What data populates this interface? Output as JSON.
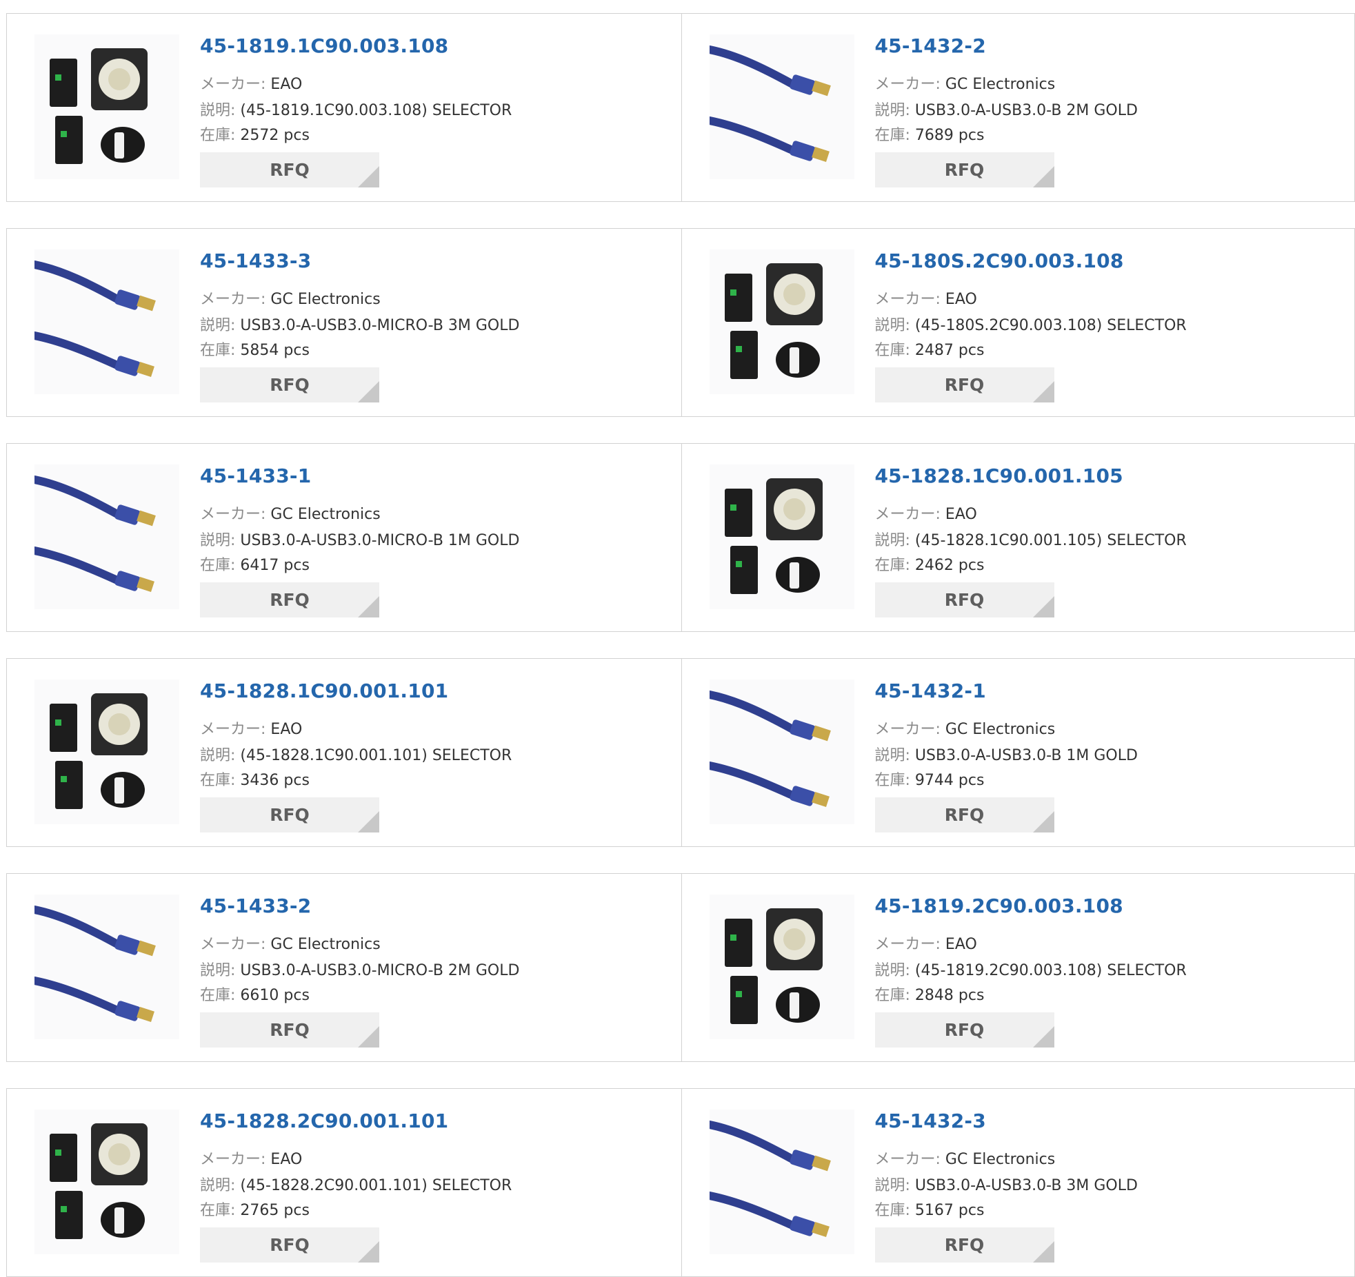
{
  "labels": {
    "maker": "メーカー:",
    "desc": "説明:",
    "stock": "在庫:",
    "rfq": "RFQ"
  },
  "colors": {
    "link": "#2466ac",
    "border": "#d2d2d2",
    "button_bg": "#f0f0f0",
    "cable_blue": "#2f3f8f",
    "connector_gold": "#c9a84a"
  },
  "products": [
    {
      "part": "45-1819.1C90.003.108",
      "maker": "EAO",
      "desc": "(45-1819.1C90.003.108) SELECTOR",
      "stock": "2572 pcs",
      "image": "selector-icon"
    },
    {
      "part": "45-1432-2",
      "maker": "GC Electronics",
      "desc": "USB3.0-A-USB3.0-B 2M GOLD",
      "stock": "7689 pcs",
      "image": "usb-cable-icon"
    },
    {
      "part": "45-1433-3",
      "maker": "GC Electronics",
      "desc": "USB3.0-A-USB3.0-MICRO-B 3M GOLD",
      "stock": "5854 pcs",
      "image": "usb-cable-icon"
    },
    {
      "part": "45-180S.2C90.003.108",
      "maker": "EAO",
      "desc": "(45-180S.2C90.003.108) SELECTOR",
      "stock": "2487 pcs",
      "image": "selector-icon"
    },
    {
      "part": "45-1433-1",
      "maker": "GC Electronics",
      "desc": "USB3.0-A-USB3.0-MICRO-B 1M GOLD",
      "stock": "6417 pcs",
      "image": "usb-cable-icon"
    },
    {
      "part": "45-1828.1C90.001.105",
      "maker": "EAO",
      "desc": "(45-1828.1C90.001.105) SELECTOR",
      "stock": "2462 pcs",
      "image": "selector-icon"
    },
    {
      "part": "45-1828.1C90.001.101",
      "maker": "EAO",
      "desc": "(45-1828.1C90.001.101) SELECTOR",
      "stock": "3436 pcs",
      "image": "selector-icon"
    },
    {
      "part": "45-1432-1",
      "maker": "GC Electronics",
      "desc": "USB3.0-A-USB3.0-B 1M GOLD",
      "stock": "9744 pcs",
      "image": "usb-cable-icon"
    },
    {
      "part": "45-1433-2",
      "maker": "GC Electronics",
      "desc": "USB3.0-A-USB3.0-MICRO-B 2M GOLD",
      "stock": "6610 pcs",
      "image": "usb-cable-icon"
    },
    {
      "part": "45-1819.2C90.003.108",
      "maker": "EAO",
      "desc": "(45-1819.2C90.003.108) SELECTOR",
      "stock": "2848 pcs",
      "image": "selector-icon"
    },
    {
      "part": "45-1828.2C90.001.101",
      "maker": "EAO",
      "desc": "(45-1828.2C90.001.101) SELECTOR",
      "stock": "2765 pcs",
      "image": "selector-icon"
    },
    {
      "part": "45-1432-3",
      "maker": "GC Electronics",
      "desc": "USB3.0-A-USB3.0-B 3M GOLD",
      "stock": "5167 pcs",
      "image": "usb-cable-icon"
    }
  ]
}
